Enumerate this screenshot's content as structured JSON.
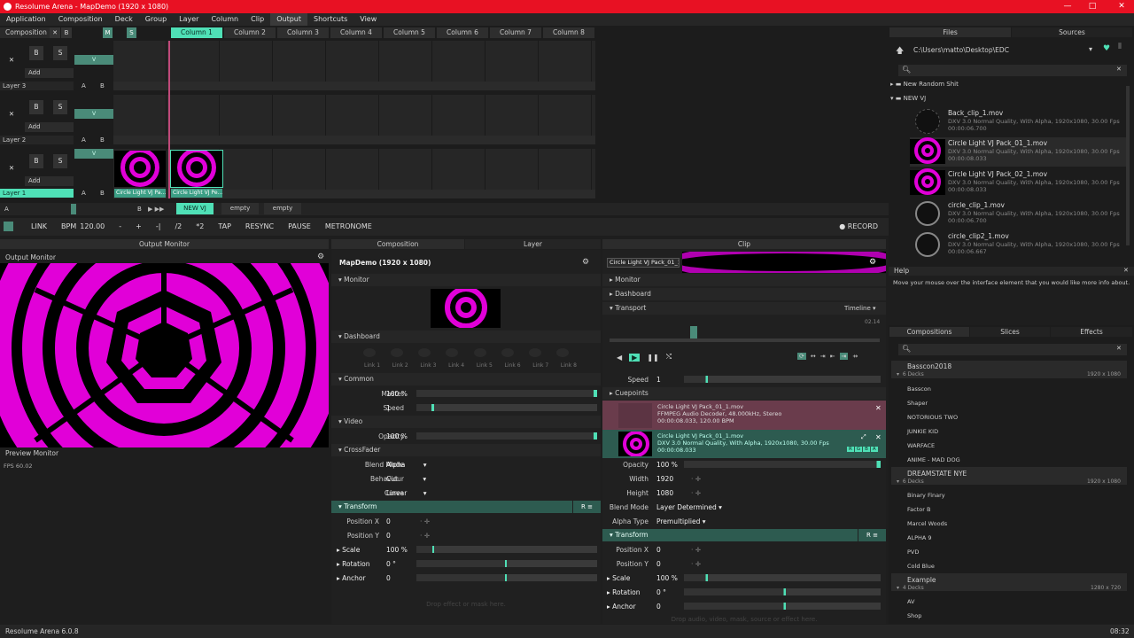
{
  "window": {
    "title": "Resolume Arena - MapDemo (1920 x 1080)",
    "min": "—",
    "max": "□",
    "close": "✕"
  },
  "menu": [
    "Application",
    "Composition",
    "Deck",
    "Group",
    "Layer",
    "Column",
    "Clip",
    "Output",
    "Shortcuts",
    "View"
  ],
  "deck": {
    "composition_label": "Composition",
    "x": "✕",
    "b": "B",
    "m": "M",
    "s": "S",
    "columns": [
      "Column 1",
      "Column 2",
      "Column 3",
      "Column 4",
      "Column 5",
      "Column 6",
      "Column 7",
      "Column 8"
    ],
    "layers": [
      {
        "name": "Layer 3",
        "add": "Add",
        "a": "A",
        "b": "B",
        "s": "S",
        "v": "V"
      },
      {
        "name": "Layer 2",
        "add": "Add",
        "a": "A",
        "b": "B",
        "s": "S",
        "v": "V"
      },
      {
        "name": "Layer 1",
        "add": "Add",
        "a": "A",
        "b": "B",
        "s": "S",
        "v": "V"
      }
    ],
    "clip_labels": [
      "Circle Light VJ Pa...",
      "Circle Light VJ Pe..."
    ],
    "decks_bar": {
      "a": "A",
      "b": "B",
      "tabs": [
        "NEW VJ",
        "empty",
        "empty"
      ]
    }
  },
  "transport": {
    "link": "LINK",
    "bpm_label": "BPM",
    "bpm": "120.00",
    "minus": "-",
    "plus": "+",
    "div": "-|",
    "half": "/2",
    "dbl": "*2",
    "tap": "TAP",
    "resync": "RESYNC",
    "pause": "PAUSE",
    "metronome": "METRONOME",
    "record": "RECORD"
  },
  "output_monitor": {
    "header": "Output Monitor",
    "title": "Output Monitor",
    "preview": "Preview Monitor",
    "fps": "FPS 60.02"
  },
  "composition_panel": {
    "tab_comp": "Composition",
    "tab_layer": "Layer",
    "title": "MapDemo (1920 x 1080)",
    "monitor": "Monitor",
    "dashboard": "Dashboard",
    "links": [
      "Link 1",
      "Link 2",
      "Link 3",
      "Link 4",
      "Link 5",
      "Link 6",
      "Link 7",
      "Link 8"
    ],
    "common": "Common",
    "master_label": "Master",
    "master": "100 %",
    "speed_label": "Speed",
    "speed": "1",
    "video": "Video",
    "opacity_label": "Opacity",
    "opacity": "100 %",
    "crossfader": "CrossFader",
    "blend_label": "Blend Mode",
    "blend": "Alpha",
    "behaviour_label": "Behaviour",
    "behaviour": "Cut",
    "curve_label": "Curve",
    "curve": "Linear",
    "transform": "Transform",
    "px_label": "Position X",
    "px": "0",
    "py_label": "Position Y",
    "py": "0",
    "scale_label": "Scale",
    "scale": "100 %",
    "rot_label": "Rotation",
    "rot": "0 °",
    "anchor_label": "Anchor",
    "anchor": "0",
    "drop": "Drop effect or mask here."
  },
  "clip_panel": {
    "header": "Clip",
    "clip_name": "Circle Light VJ Pack_01_1",
    "monitor": "Monitor",
    "dashboard": "Dashboard",
    "transport": "Transport",
    "timeline": "Timeline",
    "time": "02.14",
    "speed_label": "Speed",
    "speed": "1",
    "cuepoints": "Cuepoints",
    "audio_name": "Circle Light VJ Pack_01_1.mov",
    "audio_meta1": "FFMPEG Audio Decoder, 48.000kHz, Stereo",
    "audio_meta2": "00:00:08.033, 120.00 BPM",
    "video_name": "Circle Light VJ Pack_01_1.mov",
    "video_meta1": "DXV 3.0 Normal Quality, With Alpha, 1920x1080, 30.00 Fps",
    "video_meta2": "00:00:08.033",
    "rgba": [
      "R",
      "G",
      "B",
      "A"
    ],
    "opacity_label": "Opacity",
    "opacity": "100 %",
    "width_label": "Width",
    "width": "1920",
    "height_label": "Height",
    "height": "1080",
    "blend_label": "Blend Mode",
    "blend": "Layer Determined",
    "alpha_label": "Alpha Type",
    "alpha": "Premultiplied",
    "transform": "Transform",
    "px_label": "Position X",
    "px": "0",
    "py_label": "Position Y",
    "py": "0",
    "scale_label": "Scale",
    "scale": "100 %",
    "rot_label": "Rotation",
    "rot": "0 °",
    "anchor_label": "Anchor",
    "anchor": "0",
    "drop": "Drop audio, video, mask, source or effect here."
  },
  "files": {
    "tab_files": "Files",
    "tab_sources": "Sources",
    "path": "C:\\Users\\matto\\Desktop\\EDC",
    "folders": [
      "New Random Shit",
      "NEW VJ"
    ],
    "items": [
      {
        "name": "Back_clip_1.mov",
        "meta1": "DXV 3.0 Normal Quality, With Alpha, 1920x1080, 30.00 Fps",
        "meta2": "00:00:06.700"
      },
      {
        "name": "Circle Light VJ Pack_01_1.mov",
        "meta1": "DXV 3.0 Normal Quality, With Alpha, 1920x1080, 30.00 Fps",
        "meta2": "00:00:08.033"
      },
      {
        "name": "Circle Light VJ Pack_02_1.mov",
        "meta1": "DXV 3.0 Normal Quality, With Alpha, 1920x1080, 30.00 Fps",
        "meta2": "00:00:08.033"
      },
      {
        "name": "circle_clip_1.mov",
        "meta1": "DXV 3.0 Normal Quality, With Alpha, 1920x1080, 30.00 Fps",
        "meta2": "00:00:06.700"
      },
      {
        "name": "circle_clip2_1.mov",
        "meta1": "DXV 3.0 Normal Quality, With Alpha, 1920x1080, 30.00 Fps",
        "meta2": "00:00:06.667"
      }
    ]
  },
  "help": {
    "title": "Help",
    "text": "Move your mouse over the interface element that you would like more info about."
  },
  "browser": {
    "tab_comps": "Compositions",
    "tab_slices": "Slices",
    "tab_effects": "Effects",
    "groups": [
      {
        "name": "Basscon2018",
        "decks": "6 Decks",
        "res": "1920 x 1080",
        "items": [
          "Basscon",
          "Shaper",
          "NOTORIOUS TWO",
          "JUNKIE KID",
          "WARFACE",
          "ANIME - MAD DOG"
        ]
      },
      {
        "name": "DREAMSTATE NYE",
        "decks": "6 Decks",
        "res": "1920 x 1080",
        "items": [
          "Binary Finary",
          "Factor B",
          "Marcel Woods",
          "ALPHA 9",
          "PVD",
          "Cold Blue"
        ]
      },
      {
        "name": "Example",
        "decks": "4 Decks",
        "res": "1280 x 720",
        "items": [
          "AV",
          "Shop"
        ]
      }
    ]
  },
  "status": {
    "version": "Resolume Arena 6.0.8",
    "time": "08:32"
  },
  "colors": {
    "accent": "#4fe0b6",
    "title_red": "#e81123",
    "magenta": "#e100d8"
  }
}
